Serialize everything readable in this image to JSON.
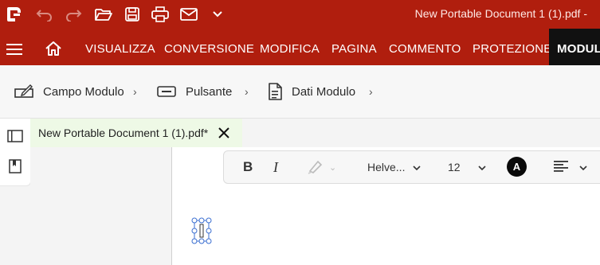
{
  "titlebar": {
    "document_title": "New Portable Document 1 (1).pdf  -",
    "icons": [
      "app-logo-icon",
      "undo-icon",
      "redo-icon",
      "open-folder-icon",
      "save-icon",
      "print-icon",
      "email-icon",
      "more-chevron-icon"
    ]
  },
  "menu": {
    "items": [
      "VISUALIZZA",
      "CONVERSIONE",
      "MODIFICA",
      "PAGINA",
      "COMMENTO",
      "PROTEZIONE"
    ],
    "active": "MODULI"
  },
  "ribbon": {
    "items": [
      {
        "label": "Campo Modulo",
        "icon": "form-field-icon"
      },
      {
        "label": "Pulsante",
        "icon": "button-icon"
      },
      {
        "label": "Dati Modulo",
        "icon": "form-data-icon"
      }
    ]
  },
  "tab": {
    "label": "New Portable Document 1 (1).pdf*",
    "active_color": "#eef9e6"
  },
  "format": {
    "bold": "B",
    "italic": "I",
    "font_name": "Helve...",
    "font_size": "12",
    "text_color_label": "A"
  },
  "colors": {
    "brand": "#b01e0e",
    "active_menu_bg": "#111111"
  }
}
